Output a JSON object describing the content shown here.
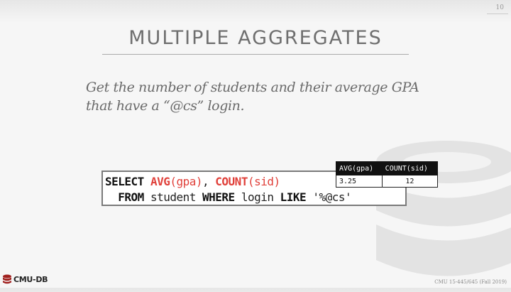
{
  "slide": {
    "number": "10",
    "title": "MULTIPLE AGGREGATES",
    "question": "Get the number of students and their average GPA that have a “@cs” login."
  },
  "sql": {
    "select_kw": "SELECT",
    "avg_fn": "AVG",
    "avg_arg": "(gpa)",
    "comma": ", ",
    "count_fn": "COUNT",
    "count_arg": "(sid)",
    "from_kw": "FROM",
    "table": "student",
    "where_kw": "WHERE",
    "column": "login",
    "like_kw": "LIKE",
    "pattern": "'%@cs'"
  },
  "result": {
    "headers": [
      "AVG(gpa)",
      "COUNT(sid)"
    ],
    "row": [
      "3.25",
      "12"
    ]
  },
  "footer": {
    "logo_text": "CMU-DB",
    "course": "CMU 15-445/645 (Fall 2019)"
  },
  "colors": {
    "function_red": "#e0403a",
    "title_gray": "#6f6f6f"
  }
}
